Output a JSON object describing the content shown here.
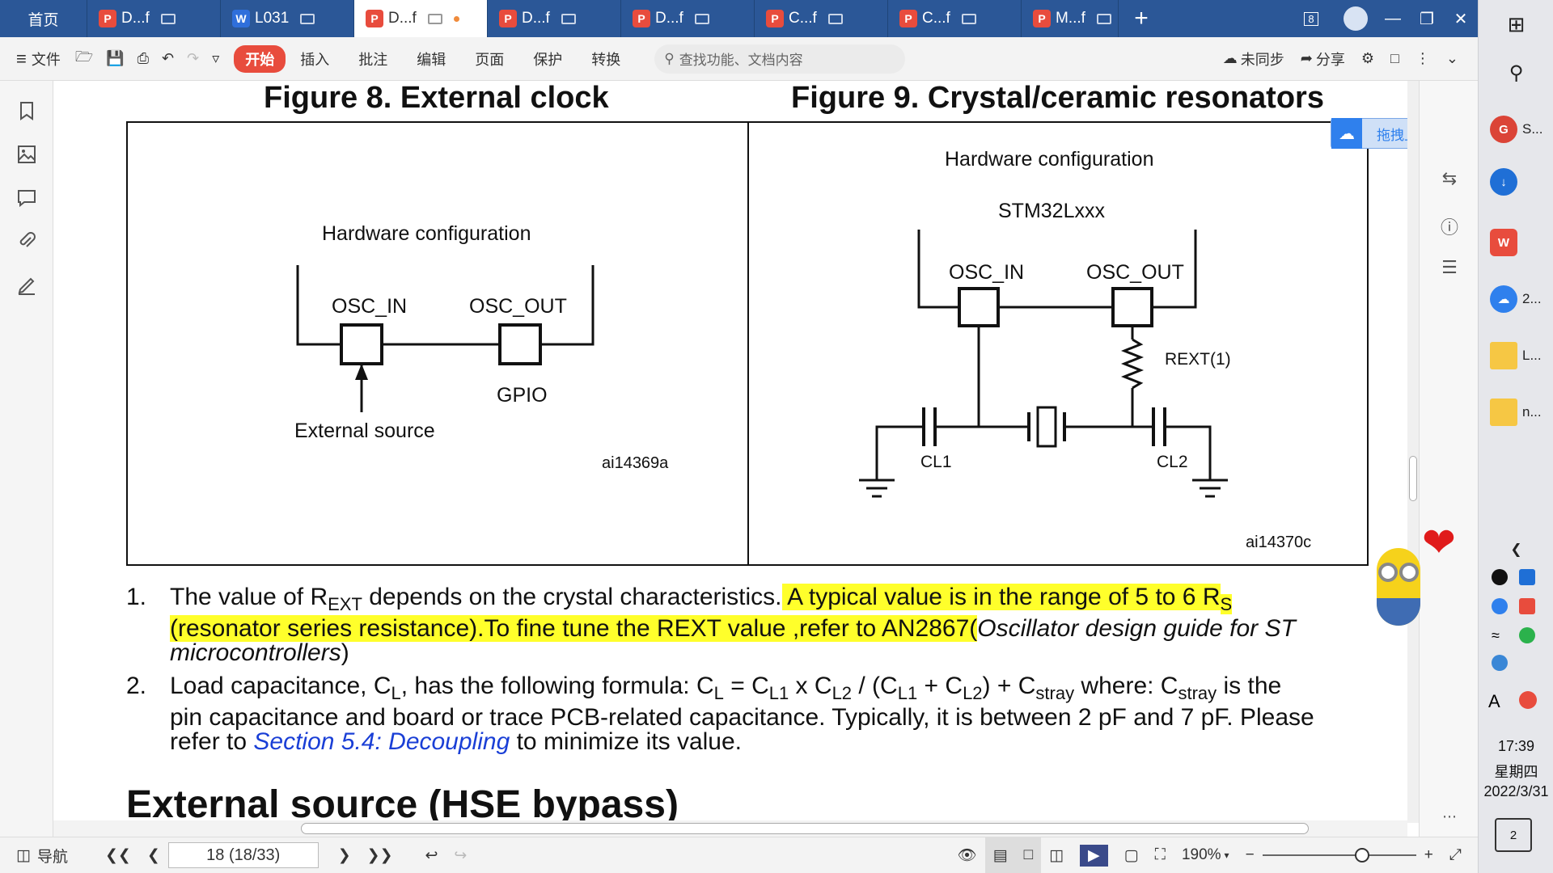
{
  "tabs": {
    "home": "首页",
    "items": [
      {
        "label": "D...f",
        "icon": "pdf",
        "active": false
      },
      {
        "label": "L031",
        "icon": "word",
        "active": false
      },
      {
        "label": "D...f",
        "icon": "pdf",
        "active": true
      },
      {
        "label": "D...f",
        "icon": "pdf",
        "active": false
      },
      {
        "label": "D...f",
        "icon": "pdf",
        "active": false
      },
      {
        "label": "C...f",
        "icon": "pdf",
        "active": false
      },
      {
        "label": "C...f",
        "icon": "pdf",
        "active": false
      },
      {
        "label": "M...f",
        "icon": "pdf",
        "active": false
      }
    ],
    "window_count": "8"
  },
  "toolbar": {
    "file": "文件",
    "menus": [
      "开始",
      "插入",
      "批注",
      "编辑",
      "页面",
      "保护",
      "转换"
    ],
    "search_placeholder": "查找功能、文档内容",
    "sync": "未同步",
    "share": "分享"
  },
  "document": {
    "fig8_title": "Figure 8. External clock",
    "fig9_title": "Figure 9. Crystal/ceramic resonators",
    "fig8": {
      "hw_config": "Hardware configuration",
      "osc_in": "OSC_IN",
      "osc_out": "OSC_OUT",
      "gpio": "GPIO",
      "ext_source": "External source",
      "code": "ai14369a"
    },
    "fig9": {
      "hw_config": "Hardware configuration",
      "chip": "STM32Lxxx",
      "osc_in": "OSC_IN",
      "osc_out": "OSC_OUT",
      "rext": "REXT(1)",
      "cl1": "CL1",
      "cl2": "CL2",
      "code": "ai14370c"
    },
    "note1": {
      "num": "1.",
      "t1": "The value of R",
      "sub1": "EXT",
      "t2": " depends on the crystal characteristics.",
      "hl1": " A typical value is in the range of 5 to 6 R",
      "hl_sub": "S",
      "hl2": "(resonator series resistance).To fine tune the REXT value ,refer to AN2867(",
      "italic": "Oscillator design guide for ST",
      "italic2": "microcontrollers",
      "t3": ")"
    },
    "note2": {
      "num": "2.",
      "l1": "Load capacitance, C",
      "l1s": "L",
      "l1b": ", has the following formula: C",
      "l1c": "L",
      "l1d": " = C",
      "l1e": "L1",
      "l1f": " x C",
      "l1g": "L2",
      "l1h": " / (C",
      "l1i": "L1",
      "l1j": " + C",
      "l1k": "L2",
      "l1l": ") + C",
      "l1m": "stray",
      "l1n": " where: C",
      "l1o": "stray",
      "l1p": " is the",
      "l2": "pin capacitance and board or trace PCB-related capacitance. Typically, it is between 2 pF and 7 pF. Please",
      "l3a": "refer to ",
      "link": "Section 5.4: Decoupling",
      "l3b": " to minimize its value."
    },
    "heading": "External source (HSE bypass)"
  },
  "upload_badge": "拖拽上传",
  "statusbar": {
    "nav": "导航",
    "page": "18 (18/33)",
    "zoom": "190%"
  },
  "taskbar": {
    "items": [
      "S...",
      "2...",
      "L...",
      "n..."
    ],
    "time": "17:39",
    "weekday": "星期四",
    "date": "2022/3/31",
    "notif": "2"
  },
  "colors": {
    "tabbar": "#2b5797",
    "highlight": "#ffff2b",
    "link": "#1a3fd6",
    "accent": "#e84c3d"
  }
}
